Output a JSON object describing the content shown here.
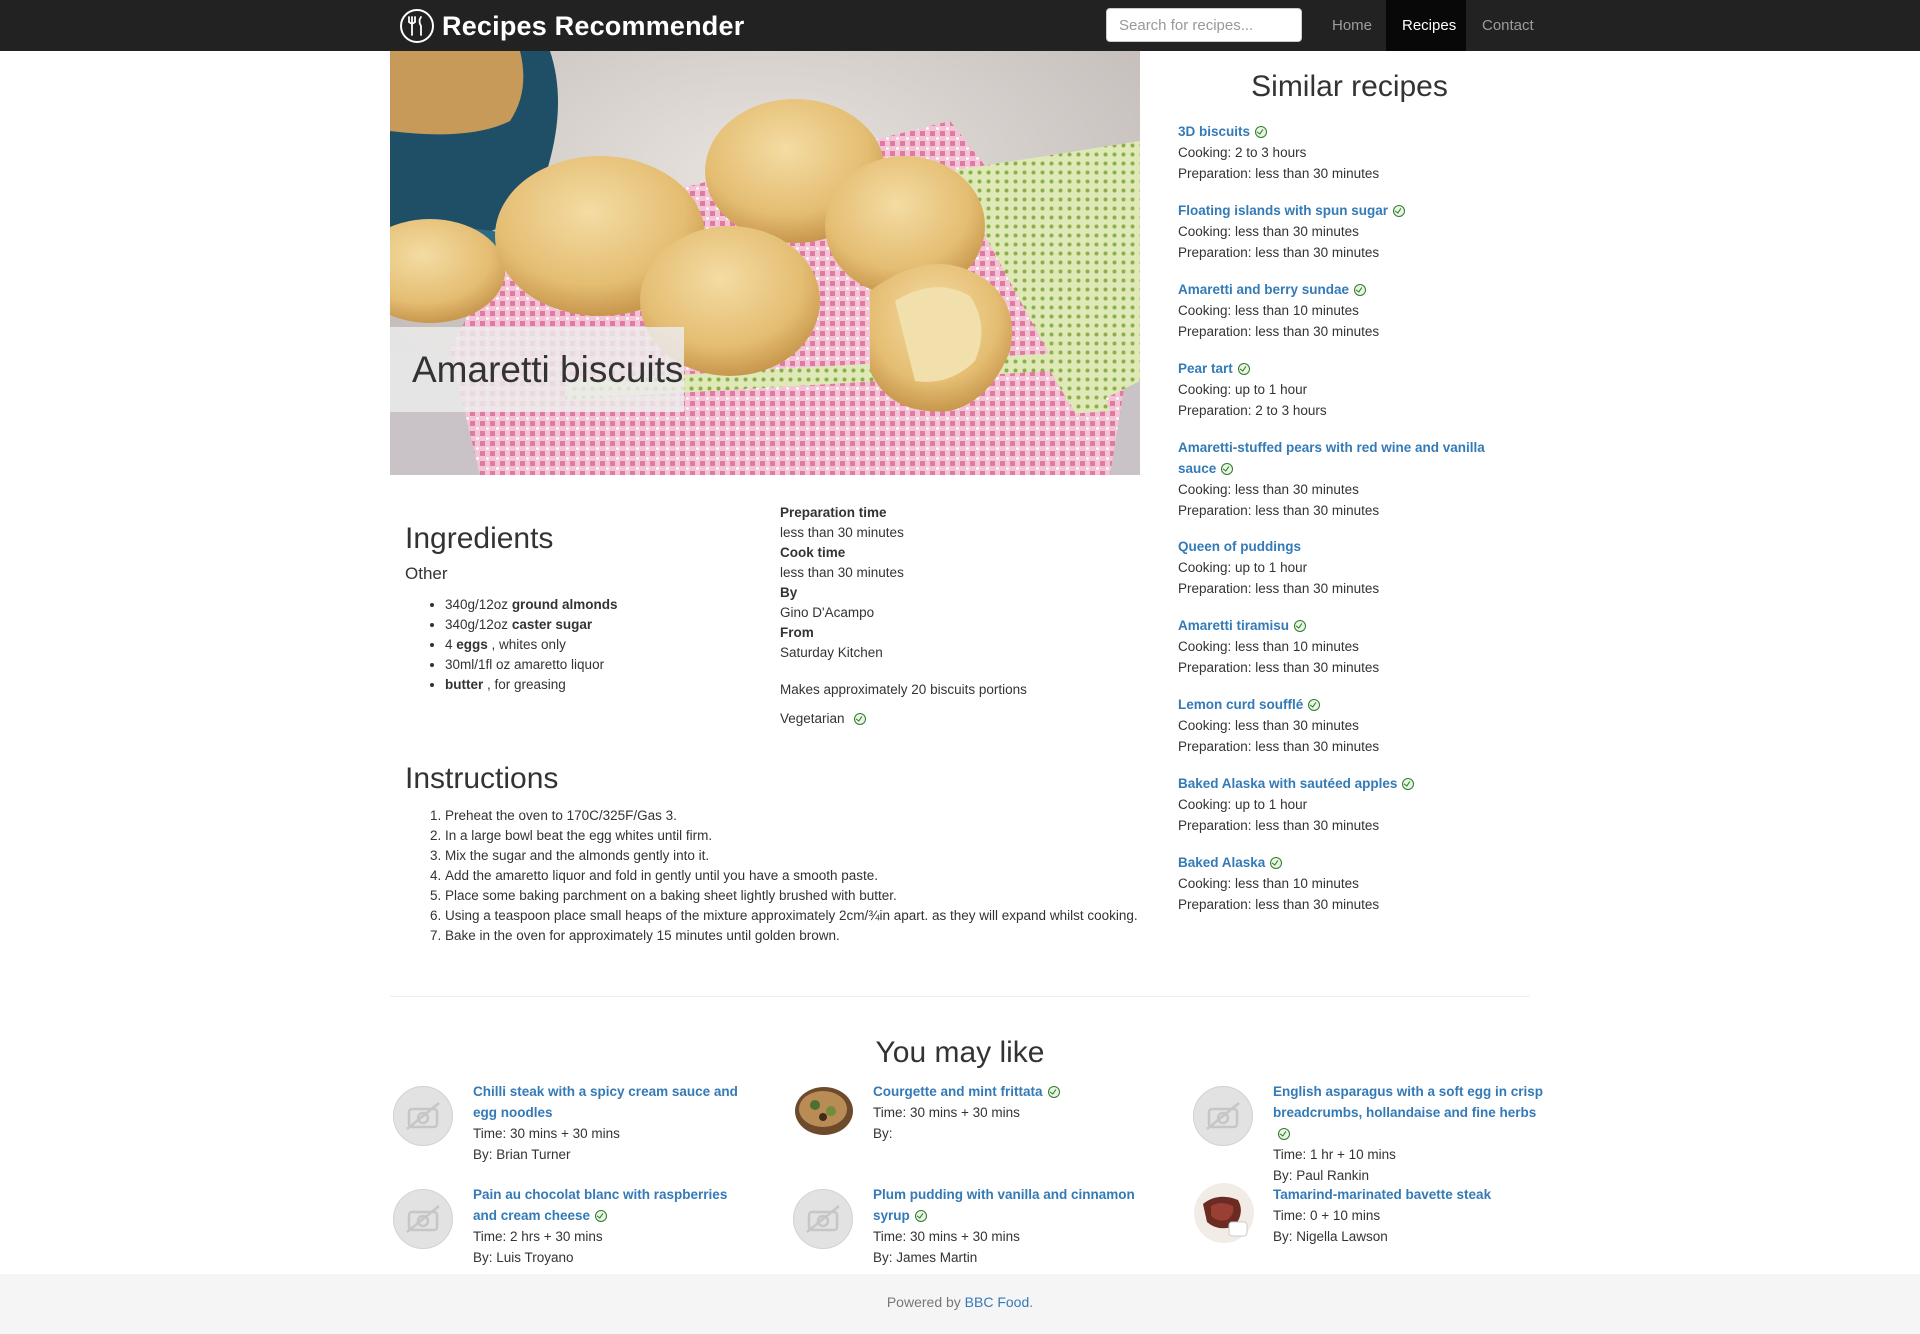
{
  "nav": {
    "brand": "Recipes Recommender",
    "search_placeholder": "Search for recipes...",
    "items": [
      {
        "label": "Home"
      },
      {
        "label": "Recipes",
        "active": true
      },
      {
        "label": "Contact"
      }
    ]
  },
  "recipe": {
    "title": "Amaretti biscuits",
    "ingredients_heading": "Ingredients",
    "group_heading": "Other",
    "ingredients": [
      {
        "pre": "340g/12oz ",
        "bold": "ground almonds",
        "post": ""
      },
      {
        "pre": "340g/12oz ",
        "bold": "caster sugar",
        "post": ""
      },
      {
        "pre": "4 ",
        "bold": "eggs",
        "post": " , whites only"
      },
      {
        "pre": "30ml/1fl oz amaretto liquor",
        "bold": "",
        "post": ""
      },
      {
        "pre": "",
        "bold": "butter",
        "post": " , for greasing"
      }
    ],
    "prep_label": "Preparation time",
    "prep_value": "less than 30 minutes",
    "cook_label": "Cook time",
    "cook_value": "less than 30 minutes",
    "by_label": "By",
    "by_value": "Gino D'Acampo",
    "from_label": "From",
    "from_value": "Saturday Kitchen",
    "makes": "Makes approximately 20 biscuits portions",
    "vegetarian": "Vegetarian",
    "instructions_heading": "Instructions",
    "instructions": [
      "Preheat the oven to 170C/325F/Gas 3.",
      "In a large bowl beat the egg whites until firm.",
      "Mix the sugar and the almonds gently into it.",
      "Add the amaretto liquor and fold in gently until you have a smooth paste.",
      "Place some baking parchment on a baking sheet lightly brushed with butter.",
      "Using a teaspoon place small heaps of the mixture approximately 2cm/¾in apart. as they will expand whilst cooking.",
      "Bake in the oven for approximately 15 minutes until golden brown."
    ]
  },
  "similar": {
    "heading": "Similar recipes",
    "items": [
      {
        "title": "3D biscuits",
        "veg": true,
        "cooking": "Cooking: 2 to 3 hours",
        "prep": "Preparation: less than 30 minutes"
      },
      {
        "title": "Floating islands with spun sugar",
        "veg": true,
        "cooking": "Cooking: less than 30 minutes",
        "prep": "Preparation: less than 30 minutes"
      },
      {
        "title": "Amaretti and berry sundae",
        "veg": true,
        "cooking": "Cooking: less than 10 minutes",
        "prep": "Preparation: less than 30 minutes"
      },
      {
        "title": "Pear tart",
        "veg": true,
        "cooking": "Cooking: up to 1 hour",
        "prep": "Preparation: 2 to 3 hours"
      },
      {
        "title": "Amaretti-stuffed pears with red wine and vanilla sauce",
        "veg": true,
        "cooking": "Cooking: less than 30 minutes",
        "prep": "Preparation: less than 30 minutes"
      },
      {
        "title": "Queen of puddings",
        "veg": false,
        "cooking": "Cooking: up to 1 hour",
        "prep": "Preparation: less than 30 minutes"
      },
      {
        "title": "Amaretti tiramisu",
        "veg": true,
        "cooking": "Cooking: less than 10 minutes",
        "prep": "Preparation: less than 30 minutes"
      },
      {
        "title": "Lemon curd soufflé",
        "veg": true,
        "cooking": "Cooking: less than 30 minutes",
        "prep": "Preparation: less than 30 minutes"
      },
      {
        "title": "Baked Alaska with sautéed apples",
        "veg": true,
        "cooking": "Cooking: up to 1 hour",
        "prep": "Preparation: less than 30 minutes"
      },
      {
        "title": "Baked Alaska",
        "veg": true,
        "cooking": "Cooking: less than 10 minutes",
        "prep": "Preparation: less than 30 minutes"
      }
    ]
  },
  "you_may_like": {
    "heading": "You may like",
    "items": [
      {
        "title": "Chilli steak with a spicy cream sauce and egg noodles",
        "veg": false,
        "time": "Time: 30 mins + 30 mins",
        "by": "By: Brian Turner",
        "thumb": "no-image"
      },
      {
        "title": "Courgette and mint frittata",
        "veg": true,
        "time": "Time: 30 mins + 30 mins",
        "by": "By:",
        "thumb": "frittata-photo"
      },
      {
        "title": "English asparagus with a soft egg in crisp breadcrumbs, hollandaise and fine herbs",
        "veg": true,
        "time": "Time: 1 hr + 10 mins",
        "by": "By: Paul Rankin",
        "thumb": "no-image"
      },
      {
        "title": "Pain au chocolat blanc with raspberries and cream cheese",
        "veg": true,
        "time": "Time: 2 hrs + 30 mins",
        "by": "By: Luis Troyano",
        "thumb": "no-image"
      },
      {
        "title": "Plum pudding with vanilla and cinnamon syrup",
        "veg": true,
        "time": "Time: 30 mins + 30 mins",
        "by": "By: James Martin",
        "thumb": "no-image"
      },
      {
        "title": "Tamarind-marinated bavette steak",
        "veg": false,
        "time": "Time: 0 + 10 mins",
        "by": "By: Nigella Lawson",
        "thumb": "steak-photo"
      }
    ]
  },
  "footer": {
    "text": "Powered by ",
    "link": "BBC Food",
    "suffix": "."
  },
  "colors": {
    "navbar": "#222222",
    "link": "#337ab7",
    "veg_icon": "#2f7a2f",
    "footer_bg": "#f5f5f5"
  }
}
